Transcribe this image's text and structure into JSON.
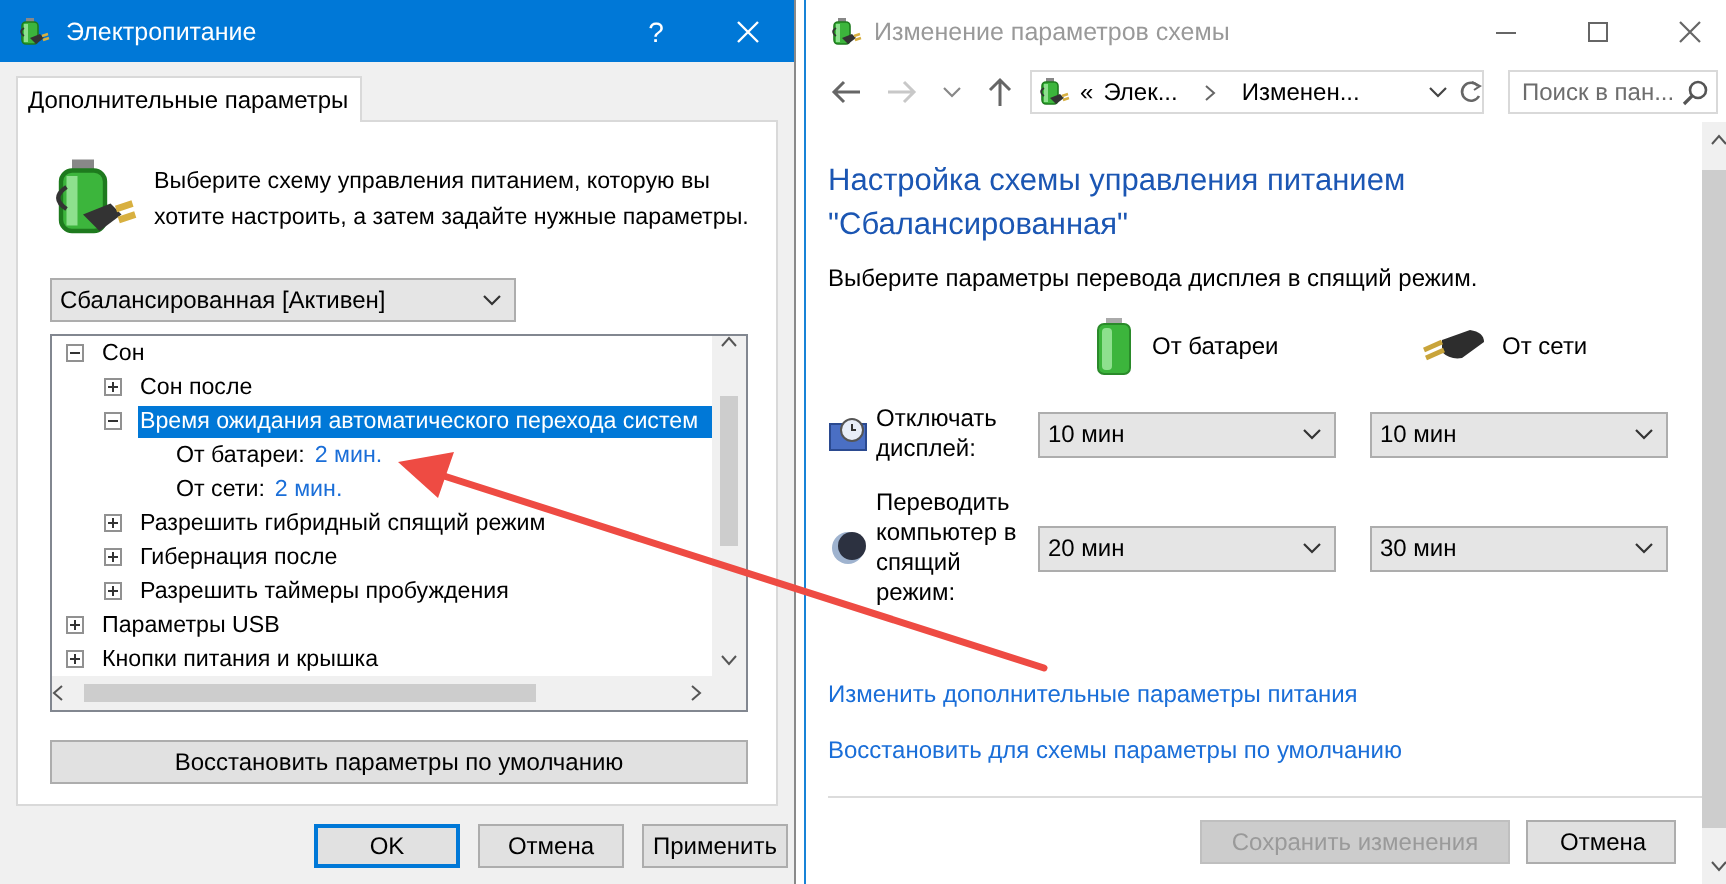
{
  "dialog": {
    "title": "Электропитание",
    "help": "?",
    "tabs": [
      {
        "label": "Дополнительные параметры",
        "selected": true
      }
    ],
    "intro": "Выберите схему управления питанием, которую вы хотите настроить, а затем задайте нужные параметры.",
    "plan": "Сбалансированная [Активен]",
    "tree": [
      {
        "kind": "node",
        "label": "Сон",
        "expanded": true,
        "selected": false,
        "children": [
          {
            "kind": "node",
            "label": "Сон после",
            "expanded": false,
            "selected": false
          },
          {
            "kind": "node",
            "label": "Время ожидания автоматического перехода систем",
            "expanded": true,
            "selected": true,
            "children": [
              {
                "kind": "setting",
                "label": "От батареи:",
                "value": "2 мин."
              },
              {
                "kind": "setting",
                "label": "От сети:",
                "value": "2 мин."
              }
            ]
          },
          {
            "kind": "node",
            "label": "Разрешить гибридный спящий режим",
            "expanded": false,
            "selected": false
          },
          {
            "kind": "node",
            "label": "Гибернация после",
            "expanded": false,
            "selected": false
          },
          {
            "kind": "node",
            "label": "Разрешить таймеры пробуждения",
            "expanded": false,
            "selected": false
          }
        ]
      },
      {
        "kind": "node",
        "label": "Параметры USB",
        "expanded": false,
        "selected": false
      },
      {
        "kind": "node",
        "label": "Кнопки питания и крышка",
        "expanded": false,
        "selected": false
      }
    ],
    "restore": "Восстановить параметры по умолчанию",
    "buttons": [
      {
        "label": "OK",
        "default": true
      },
      {
        "label": "Отмена",
        "default": false
      },
      {
        "label": "Применить",
        "default": false
      }
    ]
  },
  "window": {
    "title": "Изменение параметров схемы",
    "breadcrumb_prefix": "«",
    "breadcrumb": [
      "Элек...",
      "Изменен..."
    ],
    "search": {
      "placeholder": "Поиск в пан..."
    },
    "heading": "Настройка схемы управления питанием \"Сбалансированная\"",
    "subtitle": "Выберите параметры перевода дисплея в спящий режим.",
    "columns": [
      {
        "kind": "battery",
        "label": "От батареи"
      },
      {
        "kind": "plug",
        "label": "От сети"
      }
    ],
    "rows": [
      {
        "kind": "display",
        "label": "Отключать дисплей:",
        "values": [
          "10 мин",
          "10 мин"
        ]
      },
      {
        "kind": "sleep",
        "label": "Переводить компьютер в спящий режим:",
        "values": [
          "20 мин",
          "30 мин"
        ]
      }
    ],
    "links": [
      "Изменить дополнительные параметры питания",
      "Восстановить для схемы параметры по умолчанию"
    ],
    "buttons": [
      {
        "label": "Сохранить изменения",
        "disabled": true
      },
      {
        "label": "Отмена",
        "disabled": false
      }
    ]
  }
}
